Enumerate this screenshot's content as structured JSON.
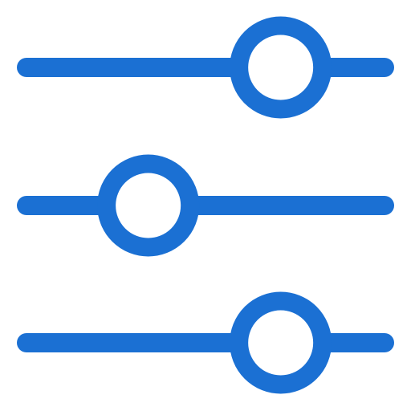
{
  "icon": {
    "name": "sliders-icon",
    "color": "#1b70d3",
    "background": "#ffffff"
  },
  "sliders": [
    {
      "name": "slider-1",
      "value": 0.71
    },
    {
      "name": "slider-2",
      "value": 0.34
    },
    {
      "name": "slider-3",
      "value": 0.71
    }
  ]
}
